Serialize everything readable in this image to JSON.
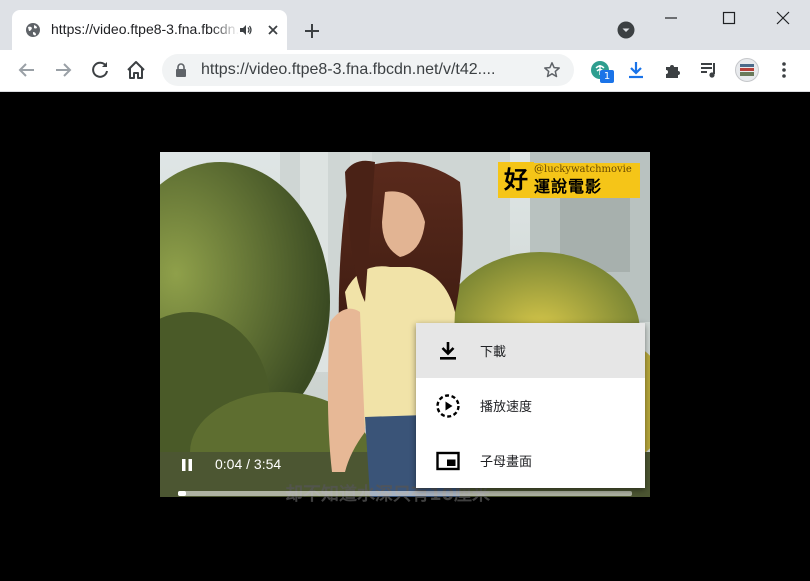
{
  "tab": {
    "title": "https://video.ftpe8-3.fna.fbcdn.net/v/t42...",
    "favicon": "globe-icon",
    "audio_icon": "speaker-icon",
    "close_icon": "close-icon"
  },
  "tabstrip": {
    "new_tab_icon": "plus-icon",
    "tab_search_icon": "chevron-down-circle-icon",
    "window_controls": [
      "minimize-icon",
      "maximize-icon",
      "close-icon"
    ]
  },
  "toolbar": {
    "url": "https://video.ftpe8-3.fna.fbcdn.net/v/t42....",
    "extension_badge": "1",
    "icons": [
      "back-icon",
      "forward-icon",
      "reload-icon",
      "home-icon",
      "lock-icon",
      "bookmark-star-icon",
      "extension-palm-icon",
      "download-icon",
      "puzzle-icon",
      "media-control-icon",
      "profile-avatar-icon",
      "more-menu-icon"
    ]
  },
  "video": {
    "watermark": {
      "badge": "好",
      "handle": "@luckywatchmovie",
      "name": "運說電影"
    },
    "subtitle": "却不知道水深只有10厘米",
    "time": {
      "current": "0:04",
      "separator": " / ",
      "duration": "3:54"
    },
    "progress_fraction": 0.017
  },
  "context_menu": {
    "items": [
      {
        "label": "下載",
        "icon": "download-icon"
      },
      {
        "label": "播放速度",
        "icon": "playback-speed-icon"
      },
      {
        "label": "子母畫面",
        "icon": "picture-in-picture-icon"
      }
    ]
  },
  "colors": {
    "tabstrip_bg": "#dee1e6",
    "accent": "#1a73e8",
    "menu_hover": "#e6e6e6",
    "watermark_yellow": "#f5c518"
  }
}
